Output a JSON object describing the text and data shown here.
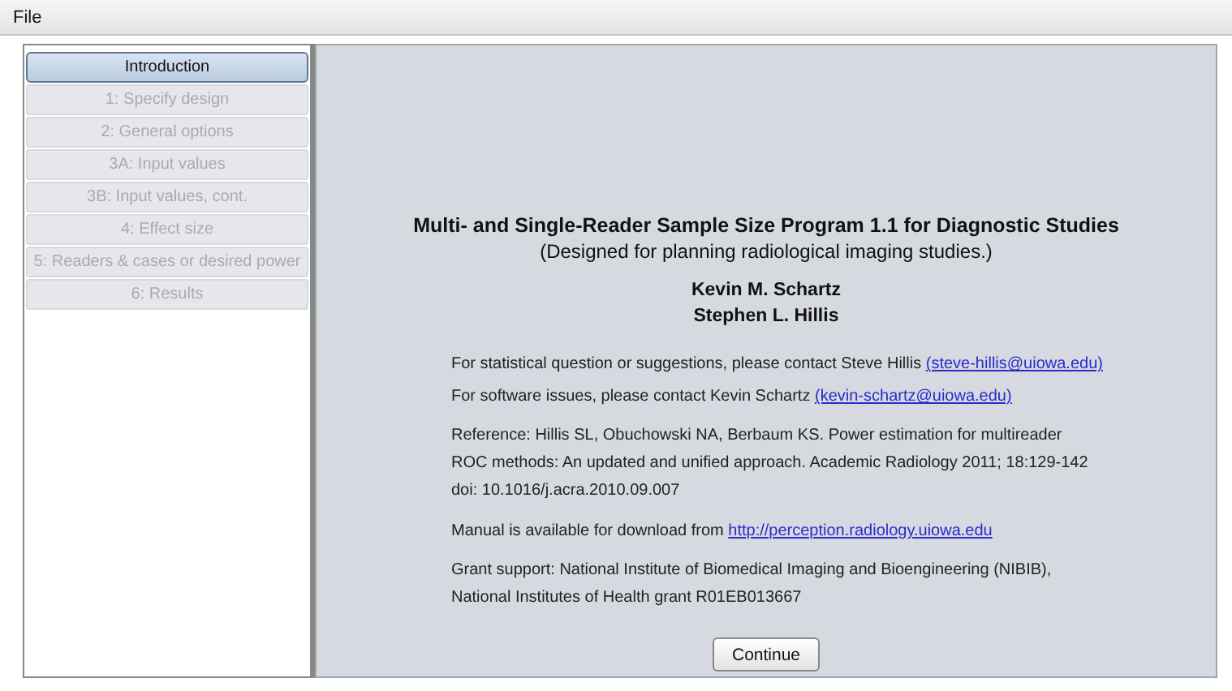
{
  "menu": [
    "File"
  ],
  "steps": [
    {
      "label": "Introduction",
      "selected": true,
      "disabled": false
    },
    {
      "label": "1: Specify design",
      "selected": false,
      "disabled": true
    },
    {
      "label": "2: General options",
      "selected": false,
      "disabled": true
    },
    {
      "label": "3A: Input values",
      "selected": false,
      "disabled": true
    },
    {
      "label": "3B: Input values, cont.",
      "selected": false,
      "disabled": true
    },
    {
      "label": "4: Effect size",
      "selected": false,
      "disabled": true
    },
    {
      "label": "5: Readers & cases or desired power",
      "selected": false,
      "disabled": true
    },
    {
      "label": "6: Results",
      "selected": false,
      "disabled": true
    }
  ],
  "intro": {
    "title": "Multi- and Single-Reader Sample Size Program 1.1 for Diagnostic Studies",
    "subtitle": "(Designed for planning radiological imaging studies.)",
    "authors": [
      "Kevin M. Schartz",
      "Stephen L. Hillis"
    ],
    "paragraphs": [
      {
        "text": "For statistical question or suggestions, please contact Steve Hillis",
        "link": "(steve-hillis@uiowa.edu)"
      },
      {
        "text": "For software issues, please contact Kevin Schartz",
        "link": "(kevin-schartz@uiowa.edu)"
      },
      {
        "lines": [
          "Reference: Hillis SL, Obuchowski NA, Berbaum KS. Power estimation for multireader",
          "ROC methods: An updated and unified approach. Academic Radiology 2011; 18:129-142",
          "doi: 10.1016/j.acra.2010.09.007"
        ]
      },
      {
        "text": "Manual is available for download from",
        "link": "http://perception.radiology.uiowa.edu"
      },
      {
        "lines": [
          "Grant support: National Institute of Biomedical Imaging and Bioengineering (NIBIB),",
          "National Institutes of Health grant R01EB013667"
        ]
      }
    ],
    "button": "Continue"
  }
}
